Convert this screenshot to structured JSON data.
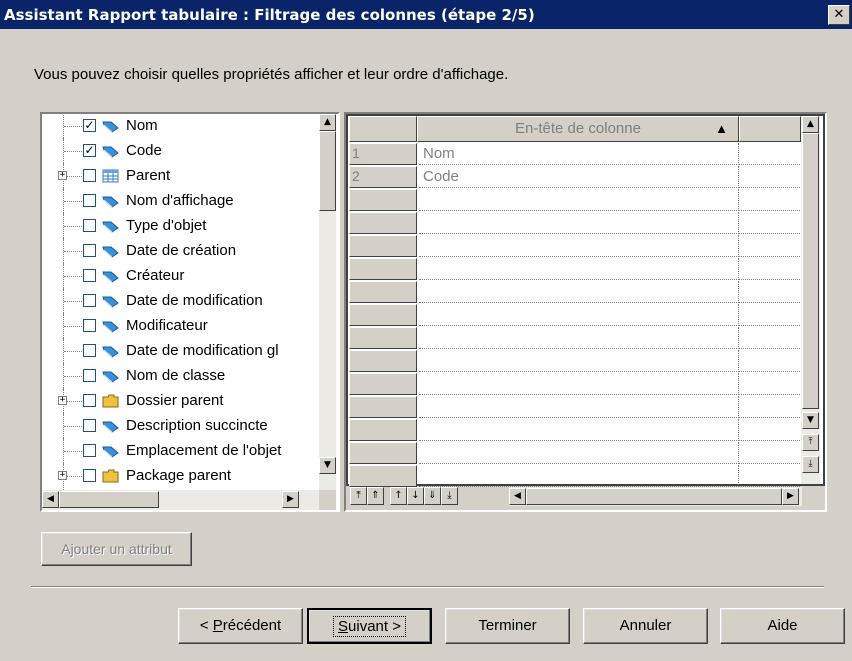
{
  "window": {
    "title": "Assistant Rapport tabulaire : Filtrage des colonnes (étape 2/5)",
    "close_glyph": "✕"
  },
  "intro": "Vous pouvez choisir quelles propriétés afficher et leur ordre d'affichage.",
  "tree": {
    "items": [
      {
        "label": "Nom",
        "checked": true,
        "icon": "property-icon",
        "expandable": false
      },
      {
        "label": "Code",
        "checked": true,
        "icon": "property-icon",
        "expandable": false
      },
      {
        "label": "Parent",
        "checked": false,
        "icon": "table-icon",
        "expandable": true
      },
      {
        "label": "Nom d'affichage",
        "checked": false,
        "icon": "property-icon",
        "expandable": false
      },
      {
        "label": "Type d'objet",
        "checked": false,
        "icon": "property-icon",
        "expandable": false
      },
      {
        "label": "Date de création",
        "checked": false,
        "icon": "property-icon",
        "expandable": false
      },
      {
        "label": "Créateur",
        "checked": false,
        "icon": "property-icon",
        "expandable": false
      },
      {
        "label": "Date de modification",
        "checked": false,
        "icon": "property-icon",
        "expandable": false
      },
      {
        "label": "Modificateur",
        "checked": false,
        "icon": "property-icon",
        "expandable": false
      },
      {
        "label": "Date de modification gl",
        "checked": false,
        "icon": "property-icon",
        "expandable": false
      },
      {
        "label": "Nom de classe",
        "checked": false,
        "icon": "property-icon",
        "expandable": false
      },
      {
        "label": "Dossier parent",
        "checked": false,
        "icon": "folder-icon",
        "expandable": true
      },
      {
        "label": "Description succincte",
        "checked": false,
        "icon": "property-icon",
        "expandable": false
      },
      {
        "label": "Emplacement de l'objet",
        "checked": false,
        "icon": "property-icon",
        "expandable": false
      },
      {
        "label": "Package parent",
        "checked": false,
        "icon": "folder-icon",
        "expandable": true
      }
    ]
  },
  "grid": {
    "header": "En-tête de colonne",
    "sort_glyph": "▲",
    "rows": [
      {
        "num": "1",
        "value": "Nom"
      },
      {
        "num": "2",
        "value": "Code"
      },
      {
        "num": "",
        "value": ""
      },
      {
        "num": "",
        "value": ""
      },
      {
        "num": "",
        "value": ""
      },
      {
        "num": "",
        "value": ""
      },
      {
        "num": "",
        "value": ""
      },
      {
        "num": "",
        "value": ""
      },
      {
        "num": "",
        "value": ""
      },
      {
        "num": "",
        "value": ""
      },
      {
        "num": "",
        "value": ""
      },
      {
        "num": "",
        "value": ""
      },
      {
        "num": "",
        "value": ""
      },
      {
        "num": "",
        "value": ""
      },
      {
        "num": "",
        "value": ""
      }
    ],
    "toolbar": [
      "⤒",
      "⇑",
      "↑",
      "↓",
      "⇓",
      "⤓"
    ]
  },
  "buttons": {
    "add_attribute": "Ajouter un attribut",
    "previous_prefix": "< ",
    "previous_mnemonic": "P",
    "previous_rest": "récédent",
    "next_mnemonic": "S",
    "next_rest": "uivant >",
    "finish": "Terminer",
    "cancel": "Annuler",
    "help": "Aide"
  },
  "colors": {
    "titlebar": "#0a246a",
    "face": "#d4d0c8",
    "disabled_text": "#808080",
    "property_icon": "#3a8fd9",
    "folder_icon": "#f0c040"
  }
}
